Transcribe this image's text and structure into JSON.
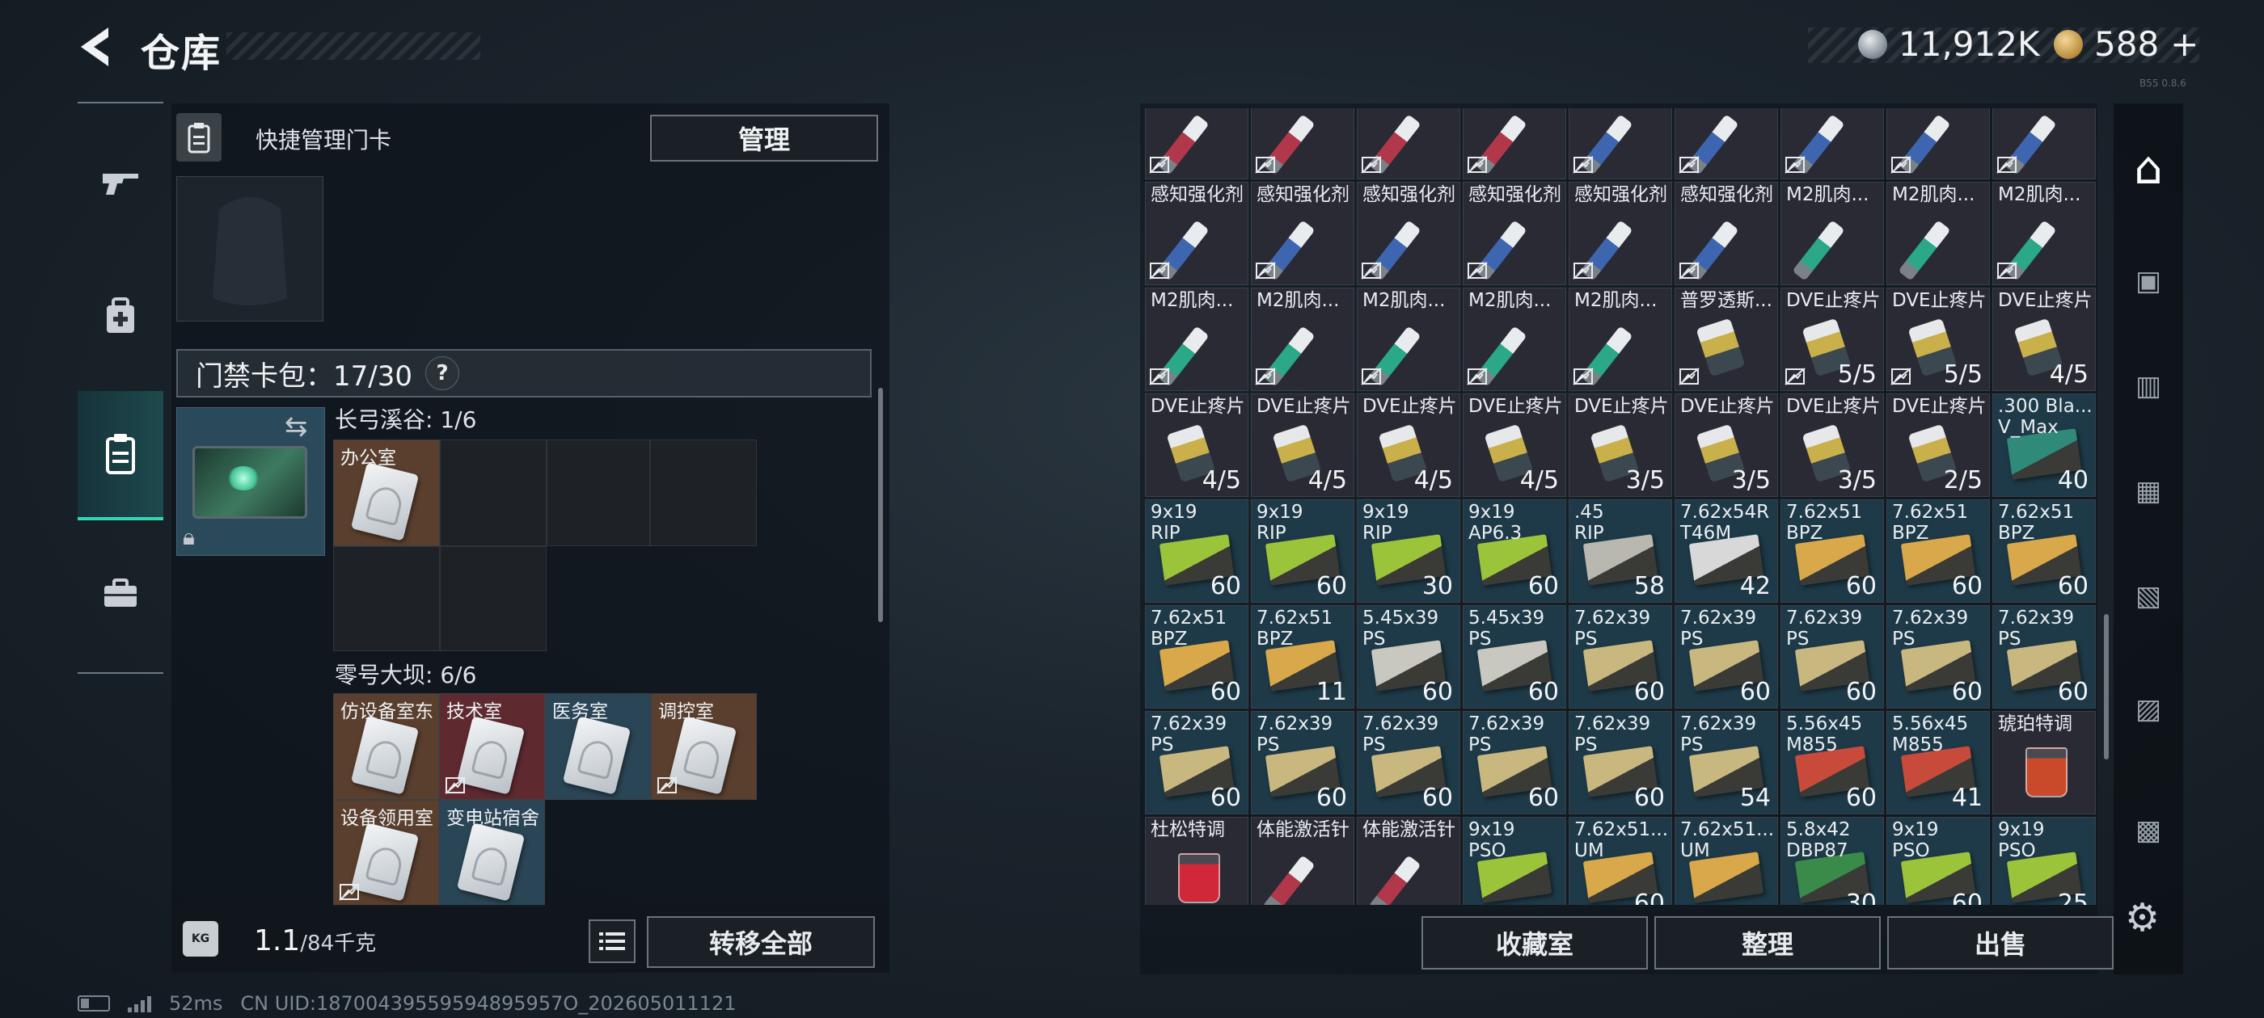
{
  "header": {
    "title": "仓库",
    "back_icon": "back-arrow-icon"
  },
  "currency": {
    "silver": "11,912K",
    "gold": "588",
    "gold_add": "+"
  },
  "version": "B55 0.8.6",
  "left_rail": {
    "items": [
      {
        "icon": "gun-icon",
        "glyph": "🔫"
      },
      {
        "icon": "medkit-bag-icon",
        "glyph": "⛑"
      },
      {
        "icon": "keycard-icon",
        "glyph": "▤",
        "selected": true
      },
      {
        "icon": "briefcase-icon",
        "glyph": "💼"
      }
    ]
  },
  "left_panel": {
    "manage_label": "快捷管理门卡",
    "manage_button": "管理",
    "cardpack_label": "门禁卡包：17/30",
    "cardpack_help": "?",
    "sections": [
      {
        "title": "长弓溪谷: 1/6",
        "cards": [
          {
            "label": "办公室",
            "color": "#5a3f2e",
            "no_insure": false
          }
        ]
      },
      {
        "title": "零号大坝: 6/6",
        "cards": [
          {
            "label": "仿设备室东",
            "color": "#5a3f2e",
            "no_insure": false
          },
          {
            "label": "技术室",
            "color": "#5e2a30",
            "no_insure": true
          },
          {
            "label": "医务室",
            "color": "#2a4556",
            "no_insure": false
          },
          {
            "label": "调控室",
            "color": "#5a3f2e",
            "no_insure": true
          },
          {
            "label": "设备领用室",
            "color": "#5a3f2e",
            "no_insure": true
          },
          {
            "label": "变电站宿舍",
            "color": "#2a4556",
            "no_insure": false
          }
        ]
      }
    ],
    "weight": "1.1",
    "weight_unit": "/84千克",
    "transfer_all": "转移全部"
  },
  "status": {
    "ping": "52ms",
    "uid": "CN UID:18700439559594895957O_202605011121"
  },
  "right_panel": {
    "items": [
      {
        "name": "",
        "count": "",
        "type": "syringe",
        "color": "#b0384a",
        "bg": "#2a2a34",
        "no_insure": true
      },
      {
        "name": "",
        "count": "",
        "type": "syringe",
        "color": "#b0384a",
        "bg": "#2a2a34",
        "no_insure": true
      },
      {
        "name": "",
        "count": "",
        "type": "syringe",
        "color": "#b0384a",
        "bg": "#2a2a34",
        "no_insure": true
      },
      {
        "name": "",
        "count": "",
        "type": "syringe",
        "color": "#b0384a",
        "bg": "#2a2a34",
        "no_insure": true
      },
      {
        "name": "",
        "count": "",
        "type": "syringe",
        "color": "#3e66b0",
        "bg": "#2a2a34",
        "no_insure": true
      },
      {
        "name": "",
        "count": "",
        "type": "syringe",
        "color": "#3e66b0",
        "bg": "#2a2a34",
        "no_insure": true
      },
      {
        "name": "",
        "count": "",
        "type": "syringe",
        "color": "#3e66b0",
        "bg": "#2a2a34",
        "no_insure": true
      },
      {
        "name": "",
        "count": "",
        "type": "syringe",
        "color": "#3e66b0",
        "bg": "#2a2a34",
        "no_insure": true
      },
      {
        "name": "",
        "count": "",
        "type": "syringe",
        "color": "#3e66b0",
        "bg": "#2a2a34",
        "no_insure": true
      },
      {
        "name": "感知强化剂",
        "count": "",
        "type": "syringe",
        "color": "#3e66b0",
        "bg": "#2a2a34",
        "no_insure": true
      },
      {
        "name": "感知强化剂",
        "count": "",
        "type": "syringe",
        "color": "#3e66b0",
        "bg": "#2a2a34",
        "no_insure": true
      },
      {
        "name": "感知强化剂",
        "count": "",
        "type": "syringe",
        "color": "#3e66b0",
        "bg": "#2a2a34",
        "no_insure": true
      },
      {
        "name": "感知强化剂",
        "count": "",
        "type": "syringe",
        "color": "#3e66b0",
        "bg": "#2a2a34",
        "no_insure": true
      },
      {
        "name": "感知强化剂",
        "count": "",
        "type": "syringe",
        "color": "#3e66b0",
        "bg": "#2a2a34",
        "no_insure": true
      },
      {
        "name": "感知强化剂",
        "count": "",
        "type": "syringe",
        "color": "#3e66b0",
        "bg": "#2a2a34",
        "no_insure": true
      },
      {
        "name": "M2肌肉...",
        "count": "",
        "type": "syringe",
        "color": "#2aa888",
        "bg": "#2a2a34",
        "no_insure": false
      },
      {
        "name": "M2肌肉...",
        "count": "",
        "type": "syringe",
        "color": "#2aa888",
        "bg": "#2a2a34",
        "no_insure": false
      },
      {
        "name": "M2肌肉...",
        "count": "",
        "type": "syringe",
        "color": "#2aa888",
        "bg": "#2a2a34",
        "no_insure": true
      },
      {
        "name": "M2肌肉...",
        "count": "",
        "type": "syringe",
        "color": "#2aa888",
        "bg": "#2a2a34",
        "no_insure": true
      },
      {
        "name": "M2肌肉...",
        "count": "",
        "type": "syringe",
        "color": "#2aa888",
        "bg": "#2a2a34",
        "no_insure": true
      },
      {
        "name": "M2肌肉...",
        "count": "",
        "type": "syringe",
        "color": "#2aa888",
        "bg": "#2a2a34",
        "no_insure": true
      },
      {
        "name": "M2肌肉...",
        "count": "",
        "type": "syringe",
        "color": "#2aa888",
        "bg": "#2a2a34",
        "no_insure": true
      },
      {
        "name": "M2肌肉...",
        "count": "",
        "type": "syringe",
        "color": "#2aa888",
        "bg": "#2a2a34",
        "no_insure": true
      },
      {
        "name": "普罗透斯...",
        "count": "",
        "type": "pillbox",
        "color": "#c9a84a",
        "bg": "#2a2a34",
        "no_insure": true
      },
      {
        "name": "DVE止疼片",
        "count": "5/5",
        "type": "pillbox",
        "color": "#c9b04a",
        "bg": "#2a2a34",
        "no_insure": true
      },
      {
        "name": "DVE止疼片",
        "count": "5/5",
        "type": "pillbox",
        "color": "#c9b04a",
        "bg": "#2a2a34",
        "no_insure": true
      },
      {
        "name": "DVE止疼片",
        "count": "4/5",
        "type": "pillbox",
        "color": "#c9b04a",
        "bg": "#2a2a34",
        "no_insure": false
      },
      {
        "name": "DVE止疼片",
        "count": "4/5",
        "type": "pillbox",
        "color": "#c9b04a",
        "bg": "#2a2a34",
        "no_insure": false
      },
      {
        "name": "DVE止疼片",
        "count": "4/5",
        "type": "pillbox",
        "color": "#c9b04a",
        "bg": "#2a2a34",
        "no_insure": false
      },
      {
        "name": "DVE止疼片",
        "count": "4/5",
        "type": "pillbox",
        "color": "#c9b04a",
        "bg": "#2a2a34",
        "no_insure": false
      },
      {
        "name": "DVE止疼片",
        "count": "4/5",
        "type": "pillbox",
        "color": "#c9b04a",
        "bg": "#2a2a34",
        "no_insure": false
      },
      {
        "name": "DVE止疼片",
        "count": "3/5",
        "type": "pillbox",
        "color": "#c9b04a",
        "bg": "#2a2a34",
        "no_insure": false
      },
      {
        "name": "DVE止疼片",
        "count": "3/5",
        "type": "pillbox",
        "color": "#c9b04a",
        "bg": "#2a2a34",
        "no_insure": false
      },
      {
        "name": "DVE止疼片",
        "count": "3/5",
        "type": "pillbox",
        "color": "#c9b04a",
        "bg": "#2a2a34",
        "no_insure": false
      },
      {
        "name": "DVE止疼片",
        "count": "2/5",
        "type": "pillbox",
        "color": "#c9b04a",
        "bg": "#2a2a34",
        "no_insure": false
      },
      {
        "name": ".300 Bla...\nV_Max",
        "count": "40",
        "type": "ammobox",
        "color": "#2f8a7a",
        "bg": "#1e3a48",
        "no_insure": false
      },
      {
        "name": "9x19\nRIP",
        "count": "60",
        "type": "ammobox",
        "color": "#9cc43a",
        "bg": "#1e3a48",
        "no_insure": false
      },
      {
        "name": "9x19\nRIP",
        "count": "60",
        "type": "ammobox",
        "color": "#9cc43a",
        "bg": "#1e3a48",
        "no_insure": false
      },
      {
        "name": "9x19\nRIP",
        "count": "30",
        "type": "ammobox",
        "color": "#9cc43a",
        "bg": "#1e3a48",
        "no_insure": false
      },
      {
        "name": "9x19\nAP6.3",
        "count": "60",
        "type": "ammobox",
        "color": "#9cc43a",
        "bg": "#1e3a48",
        "no_insure": false
      },
      {
        "name": ".45\nRIP",
        "count": "58",
        "type": "ammobox",
        "color": "#b8b8b0",
        "bg": "#1e3a48",
        "no_insure": false
      },
      {
        "name": "7.62x54R\nT46M",
        "count": "42",
        "type": "ammobox",
        "color": "#d8d8d8",
        "bg": "#1e3a48",
        "no_insure": false
      },
      {
        "name": "7.62x51\nBPZ",
        "count": "60",
        "type": "ammobox",
        "color": "#d8a84a",
        "bg": "#1e3a48",
        "no_insure": false
      },
      {
        "name": "7.62x51\nBPZ",
        "count": "60",
        "type": "ammobox",
        "color": "#d8a84a",
        "bg": "#1e3a48",
        "no_insure": false
      },
      {
        "name": "7.62x51\nBPZ",
        "count": "60",
        "type": "ammobox",
        "color": "#d8a84a",
        "bg": "#1e3a48",
        "no_insure": false
      },
      {
        "name": "7.62x51\nBPZ",
        "count": "60",
        "type": "ammobox",
        "color": "#d8a84a",
        "bg": "#1e3a48",
        "no_insure": false
      },
      {
        "name": "7.62x51\nBPZ",
        "count": "11",
        "type": "ammobox",
        "color": "#d8a84a",
        "bg": "#1e3a48",
        "no_insure": false
      },
      {
        "name": "5.45x39\nPS",
        "count": "60",
        "type": "ammobox",
        "color": "#c8c8c0",
        "bg": "#1e3a48",
        "no_insure": false
      },
      {
        "name": "5.45x39\nPS",
        "count": "60",
        "type": "ammobox",
        "color": "#c8c8c0",
        "bg": "#1e3a48",
        "no_insure": false
      },
      {
        "name": "7.62x39\nPS",
        "count": "60",
        "type": "ammobox",
        "color": "#c8b880",
        "bg": "#1e3a48",
        "no_insure": false
      },
      {
        "name": "7.62x39\nPS",
        "count": "60",
        "type": "ammobox",
        "color": "#c8b880",
        "bg": "#1e3a48",
        "no_insure": false
      },
      {
        "name": "7.62x39\nPS",
        "count": "60",
        "type": "ammobox",
        "color": "#c8b880",
        "bg": "#1e3a48",
        "no_insure": false
      },
      {
        "name": "7.62x39\nPS",
        "count": "60",
        "type": "ammobox",
        "color": "#c8b880",
        "bg": "#1e3a48",
        "no_insure": false
      },
      {
        "name": "7.62x39\nPS",
        "count": "60",
        "type": "ammobox",
        "color": "#c8b880",
        "bg": "#1e3a48",
        "no_insure": false
      },
      {
        "name": "7.62x39\nPS",
        "count": "60",
        "type": "ammobox",
        "color": "#c8b880",
        "bg": "#1e3a48",
        "no_insure": false
      },
      {
        "name": "7.62x39\nPS",
        "count": "60",
        "type": "ammobox",
        "color": "#c8b880",
        "bg": "#1e3a48",
        "no_insure": false
      },
      {
        "name": "7.62x39\nPS",
        "count": "60",
        "type": "ammobox",
        "color": "#c8b880",
        "bg": "#1e3a48",
        "no_insure": false
      },
      {
        "name": "7.62x39\nPS",
        "count": "60",
        "type": "ammobox",
        "color": "#c8b880",
        "bg": "#1e3a48",
        "no_insure": false
      },
      {
        "name": "7.62x39\nPS",
        "count": "60",
        "type": "ammobox",
        "color": "#c8b880",
        "bg": "#1e3a48",
        "no_insure": false
      },
      {
        "name": "7.62x39\nPS",
        "count": "54",
        "type": "ammobox",
        "color": "#c8b880",
        "bg": "#1e3a48",
        "no_insure": false
      },
      {
        "name": "5.56x45\nM855",
        "count": "60",
        "type": "ammobox",
        "color": "#c84a3a",
        "bg": "#1e3a48",
        "no_insure": false
      },
      {
        "name": "5.56x45\nM855",
        "count": "41",
        "type": "ammobox",
        "color": "#c84a3a",
        "bg": "#1e3a48",
        "no_insure": false
      },
      {
        "name": "琥珀特调",
        "count": "",
        "type": "drink",
        "color": "#c84a2a",
        "bg": "#2a2a34",
        "no_insure": false
      },
      {
        "name": "杜松特调",
        "count": "",
        "type": "drink",
        "color": "#d02838",
        "bg": "#2a2a34",
        "no_insure": false
      },
      {
        "name": "体能激活针",
        "count": "",
        "type": "syringe",
        "color": "#b0384a",
        "bg": "#2a2a34",
        "no_insure": false
      },
      {
        "name": "体能激活针",
        "count": "",
        "type": "syringe",
        "color": "#b0384a",
        "bg": "#2a2a34",
        "no_insure": false
      },
      {
        "name": "9x19\nPSO",
        "count": "",
        "type": "ammobox",
        "color": "#9cc43a",
        "bg": "#1e3a48",
        "no_insure": false
      },
      {
        "name": "7.62x51...\nUM",
        "count": "60",
        "type": "ammobox",
        "color": "#d8a84a",
        "bg": "#1e3a48",
        "no_insure": false
      },
      {
        "name": "7.62x51...\nUM",
        "count": "",
        "type": "ammobox",
        "color": "#d8a84a",
        "bg": "#1e3a48",
        "no_insure": false
      },
      {
        "name": "5.8x42\nDBP87",
        "count": "30",
        "type": "ammobox",
        "color": "#3a8a4a",
        "bg": "#1e3a48",
        "no_insure": false
      },
      {
        "name": "9x19\nPSO",
        "count": "60",
        "type": "ammobox",
        "color": "#9cc43a",
        "bg": "#1e3a48",
        "no_insure": false
      },
      {
        "name": "9x19\nPSO",
        "count": "25",
        "type": "ammobox",
        "color": "#9cc43a",
        "bg": "#1e3a48",
        "no_insure": false
      }
    ],
    "buttons": {
      "collection": "收藏室",
      "sort": "整理",
      "sell": "出售"
    },
    "tabs": [
      {
        "icon": "warehouse-icon",
        "glyph": "⌂",
        "selected": true
      },
      {
        "icon": "container-iii-icon",
        "glyph": "▣"
      },
      {
        "icon": "container-iv-folder-icon",
        "glyph": "▥"
      },
      {
        "icon": "container-iv-gun-icon",
        "glyph": "▦"
      },
      {
        "icon": "container-iv-card-icon",
        "glyph": "▧"
      },
      {
        "icon": "container-v-icon",
        "glyph": "▨"
      },
      {
        "icon": "container-iv-icon",
        "glyph": "▩"
      }
    ],
    "settings_icon": "gear-icon"
  }
}
